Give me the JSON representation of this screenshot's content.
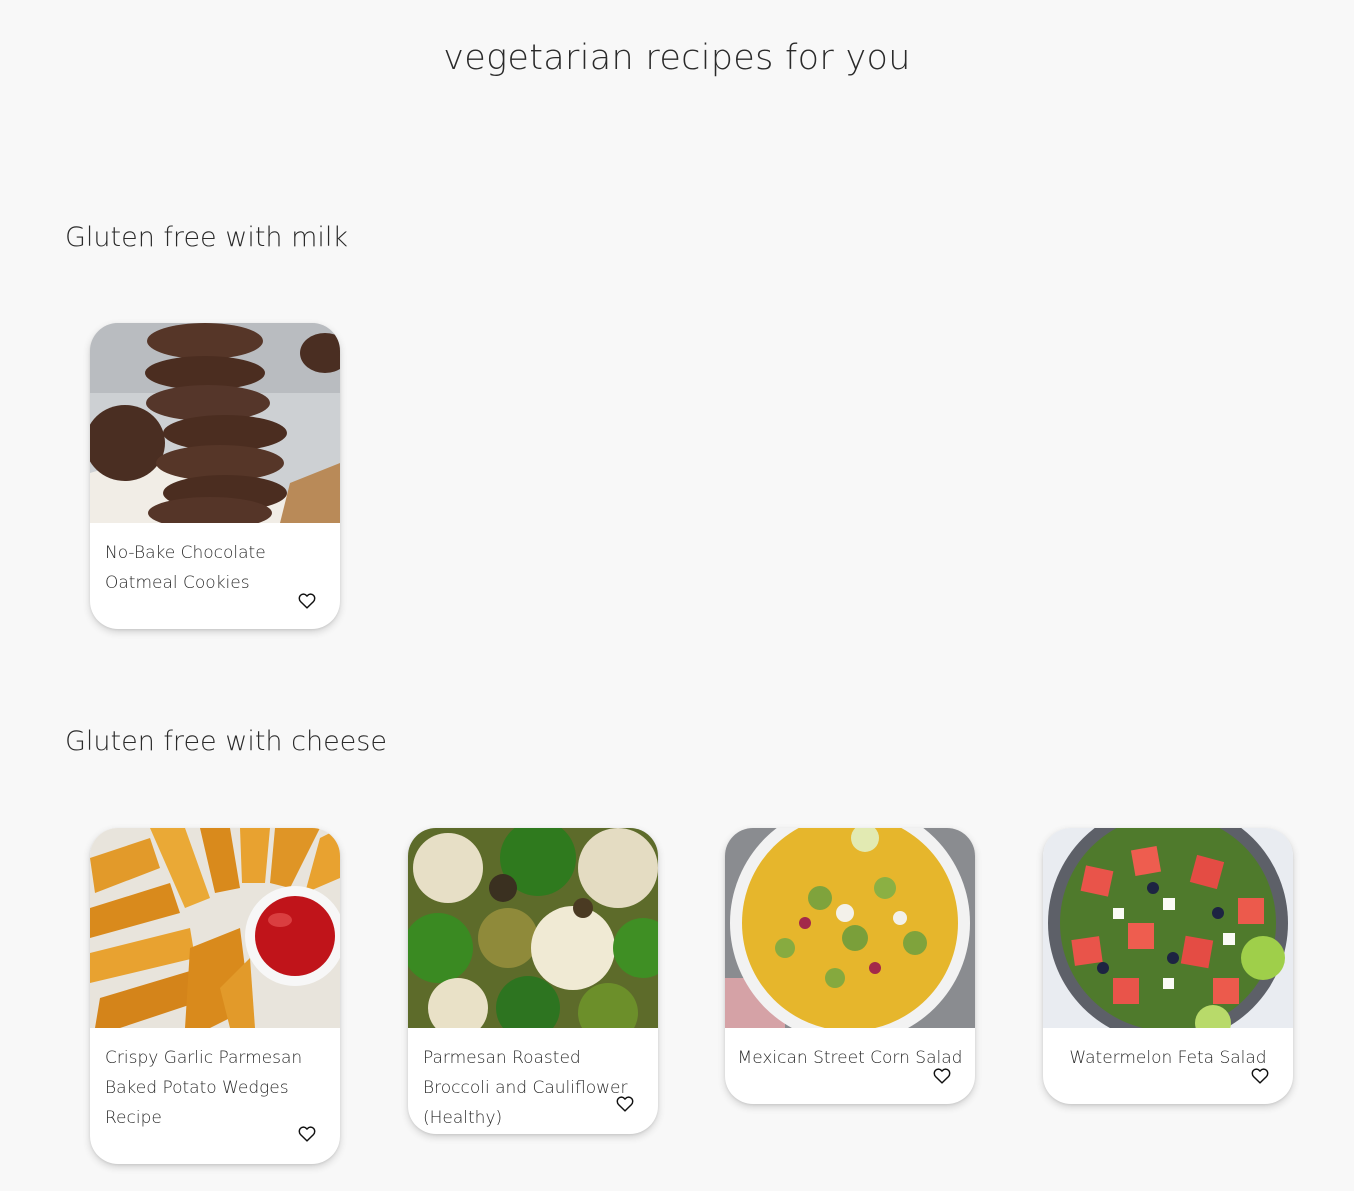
{
  "page": {
    "title": "vegetarian recipes for you"
  },
  "sections": [
    {
      "title": "Gluten free with milk",
      "recipes": [
        {
          "title": "No-Bake Chocolate Oatmeal Cookies",
          "image": "chocolate-oatmeal-cookies-photo"
        }
      ]
    },
    {
      "title": "Gluten free with cheese",
      "recipes": [
        {
          "title": "Crispy Garlic Parmesan Baked Potato Wedges Recipe",
          "image": "potato-wedges-photo"
        },
        {
          "title": "Parmesan Roasted Broccoli and Cauliflower (Healthy)",
          "image": "broccoli-cauliflower-photo"
        },
        {
          "title": "Mexican Street Corn Salad",
          "image": "corn-salad-photo"
        },
        {
          "title": "Watermelon Feta Salad",
          "image": "watermelon-feta-salad-photo"
        }
      ]
    }
  ],
  "icons": {
    "favorite": "heart-outline-icon"
  },
  "colors": {
    "background": "#f8f8f8",
    "card": "#ffffff",
    "text": "#2a2a2a"
  }
}
